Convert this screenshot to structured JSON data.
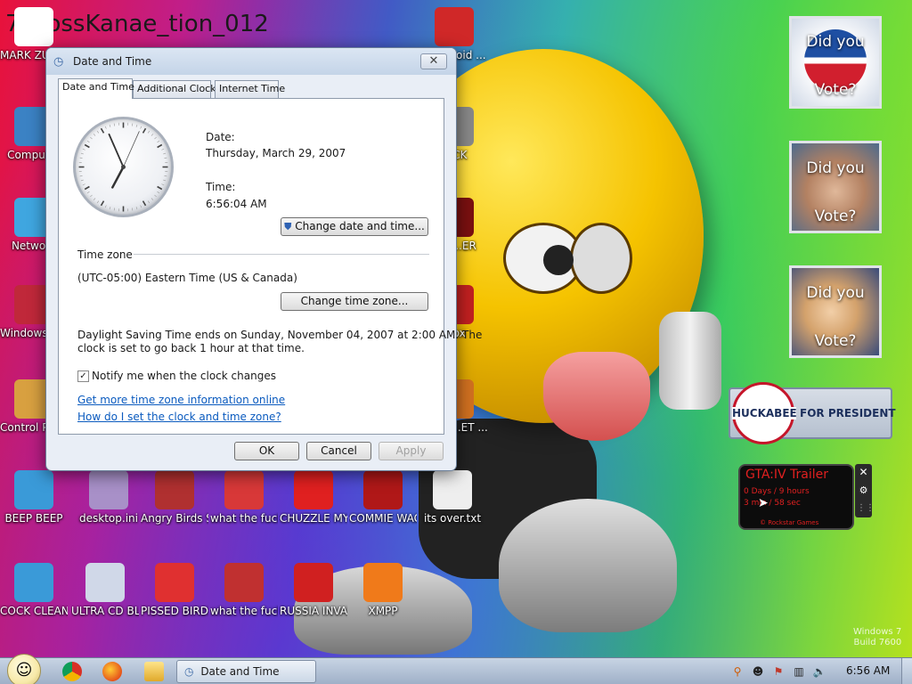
{
  "colors": {
    "accent": "#3d6aa6",
    "link": "#0b5bbf",
    "dialog_bg": "#e9eef6",
    "taskbar": "#b3c2d6",
    "gta_red": "#e02020"
  },
  "icons": {
    "dialog_title_icon": "clock-icon",
    "shield_icon": "uac-shield-icon",
    "close_icon": "close-icon"
  },
  "desktop": {
    "top_title_text": "7_RossKanae_tion_012",
    "icons": [
      {
        "label": "MARK ZUCKERBERG",
        "color": "#ffffff"
      },
      {
        "label": "Computer",
        "color": "#3b82c4"
      },
      {
        "label": "Network",
        "color": "#3fa6e0"
      },
      {
        "label": "Windows Vista",
        "color": "#c0283a"
      },
      {
        "label": "Control Panel",
        "color": "#d8a040"
      },
      {
        "label": "BEEP BEEP",
        "color": "#3a9ad8"
      },
      {
        "label": "desktop.ini",
        "color": "#a890c8"
      },
      {
        "label": "Angry Birds Star Wars",
        "color": "#b03030"
      },
      {
        "label": "what the fuck is going on ...",
        "color": "#d83838"
      },
      {
        "label": "CHUZZLE MY CUM",
        "color": "#e02020"
      },
      {
        "label": "COMMIE WAGECU...",
        "color": "#b01818"
      },
      {
        "label": "its over.txt",
        "color": "#eeeeee"
      },
      {
        "label": "COCK CLEANER",
        "color": "#3a9ad8"
      },
      {
        "label": "ULTRA CD BLOATWARE",
        "color": "#d0d8e8"
      },
      {
        "label": "PISSED BIRDS IN VIDEO G...",
        "color": "#e03030"
      },
      {
        "label": "what the fuck is going on ...",
        "color": "#c03030"
      },
      {
        "label": "RUSSIA INVADES ...",
        "color": "#d02020"
      },
      {
        "label": "XMPP",
        "color": "#f07a1a"
      },
      {
        "label": "I are void ...",
        "color": "#d02828"
      },
      {
        "label": "DICK",
        "color": "#888888"
      },
      {
        "label": "NO ...ER",
        "color": "#7a1010"
      },
      {
        "label": "...ox",
        "color": "#c02020"
      },
      {
        "label": "...GO ...ET ...",
        "color": "#d07020"
      }
    ],
    "watermark_line1": "Windows 7",
    "watermark_line2": "Build 7600"
  },
  "dialog": {
    "title": "Date and Time",
    "close_glyph": "✕",
    "tabs": [
      {
        "label": "Date and Time",
        "active": true
      },
      {
        "label": "Additional Clocks",
        "active": false
      },
      {
        "label": "Internet Time",
        "active": false
      }
    ],
    "clock": {
      "hour": 6,
      "minute": 56,
      "second": 4
    },
    "date_label": "Date:",
    "date_value": "Thursday, March 29, 2007",
    "time_label": "Time:",
    "time_value": "6:56:04 AM",
    "change_datetime_button": "Change date and time...",
    "timezone_heading": "Time zone",
    "timezone_value": "(UTC-05:00) Eastern Time (US & Canada)",
    "change_timezone_button": "Change time zone...",
    "dst_line1": "Daylight Saving Time ends on Sunday, November 04, 2007 at 2:00 AM. The",
    "dst_line2": "clock is set to go back 1 hour at that time.",
    "notify_checked": true,
    "notify_label": "Notify me when the clock changes",
    "link_more_info": "Get more time zone information online",
    "link_how_to": "How do I set the clock and time zone?",
    "ok_button": "OK",
    "cancel_button": "Cancel",
    "apply_button": "Apply"
  },
  "widgets": {
    "poster_obama_top": "Did you",
    "poster_obama_bottom": "Vote?",
    "poster_mccain_top": "Did you",
    "poster_mccain_bottom": "Vote?",
    "poster_clinton_top": "Did you",
    "poster_clinton_bottom": "Vote?",
    "huckabee_name": "HUCKABEE",
    "huckabee_tagline": "FOR PRESIDENT",
    "gta_title": "GTA:IV Trailer",
    "gta_line1": "0 Days / 9 hours",
    "gta_line2": "3 min / 58 sec",
    "gta_footer": "© Rockstar Games"
  },
  "taskbar": {
    "start_glyph": "☺",
    "task_label": "Date and Time",
    "clock": "6:56 AM"
  }
}
